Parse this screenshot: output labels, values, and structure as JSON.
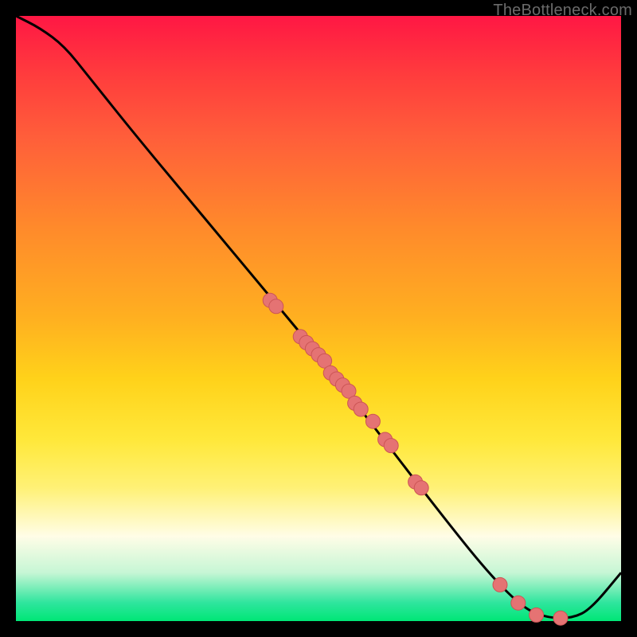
{
  "watermark": "TheBottleneck.com",
  "colors": {
    "curve_stroke": "#000000",
    "point_fill": "#e57373",
    "point_stroke": "#cc5555"
  },
  "chart_data": {
    "type": "line",
    "title": "",
    "xlabel": "",
    "ylabel": "",
    "xlim": [
      0,
      100
    ],
    "ylim": [
      0,
      100
    ],
    "note": "No axes/ticks visible; coordinates are relative percentages of plot area. Curve y-values interpreted such that y=100 is top, y=0 is bottom.",
    "curve": [
      {
        "x": 0,
        "y": 100
      },
      {
        "x": 4,
        "y": 98
      },
      {
        "x": 8,
        "y": 95
      },
      {
        "x": 12,
        "y": 90
      },
      {
        "x": 20,
        "y": 80
      },
      {
        "x": 30,
        "y": 68
      },
      {
        "x": 40,
        "y": 56
      },
      {
        "x": 50,
        "y": 44
      },
      {
        "x": 60,
        "y": 31
      },
      {
        "x": 70,
        "y": 18
      },
      {
        "x": 78,
        "y": 8
      },
      {
        "x": 84,
        "y": 2
      },
      {
        "x": 88,
        "y": 0.5
      },
      {
        "x": 92,
        "y": 0.5
      },
      {
        "x": 95,
        "y": 2
      },
      {
        "x": 100,
        "y": 8
      }
    ],
    "points": [
      {
        "x": 42,
        "y": 53
      },
      {
        "x": 43,
        "y": 52
      },
      {
        "x": 47,
        "y": 47
      },
      {
        "x": 48,
        "y": 46
      },
      {
        "x": 49,
        "y": 45
      },
      {
        "x": 50,
        "y": 44
      },
      {
        "x": 51,
        "y": 43
      },
      {
        "x": 52,
        "y": 41
      },
      {
        "x": 53,
        "y": 40
      },
      {
        "x": 54,
        "y": 39
      },
      {
        "x": 55,
        "y": 38
      },
      {
        "x": 56,
        "y": 36
      },
      {
        "x": 57,
        "y": 35
      },
      {
        "x": 59,
        "y": 33
      },
      {
        "x": 61,
        "y": 30
      },
      {
        "x": 62,
        "y": 29
      },
      {
        "x": 66,
        "y": 23
      },
      {
        "x": 67,
        "y": 22
      },
      {
        "x": 80,
        "y": 6
      },
      {
        "x": 83,
        "y": 3
      },
      {
        "x": 86,
        "y": 1
      },
      {
        "x": 90,
        "y": 0.5
      }
    ],
    "point_radius": 9
  }
}
